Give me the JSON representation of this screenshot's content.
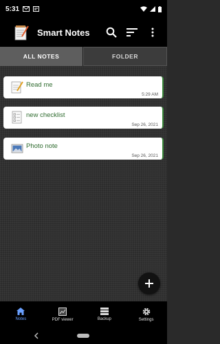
{
  "status_bar": {
    "time": "5:31",
    "icons": [
      "gmail-icon",
      "notification-icon",
      "wifi-icon",
      "signal-icon",
      "battery-icon"
    ]
  },
  "app_bar": {
    "title": "Smart Notes",
    "actions": [
      "search-icon",
      "sort-icon",
      "more-vert-icon"
    ]
  },
  "tabs": [
    {
      "label": "ALL NOTES",
      "active": true
    },
    {
      "label": "FOLDER",
      "active": false
    }
  ],
  "notes": [
    {
      "title": "Read me",
      "date": "5:29 AM",
      "icon": "note-pencil-icon"
    },
    {
      "title": "new checklist",
      "date": "Sep 26, 2021",
      "icon": "checklist-icon"
    },
    {
      "title": "Photo note",
      "date": "Sep 26, 2021",
      "icon": "photo-icon"
    }
  ],
  "fab": {
    "icon": "add-icon"
  },
  "bottom_nav": [
    {
      "label": "Notes",
      "icon": "home-icon",
      "active": true
    },
    {
      "label": "PDF viewer",
      "icon": "pdf-icon",
      "active": false
    },
    {
      "label": "Backup",
      "icon": "backup-icon",
      "active": false
    },
    {
      "label": "Settings",
      "icon": "gear-icon",
      "active": false
    }
  ],
  "colors": {
    "accent_nav": "#6aa0ff",
    "note_title": "#2f6b2f",
    "card_border": "#3c8a3c",
    "background": "#2a2a2a"
  }
}
